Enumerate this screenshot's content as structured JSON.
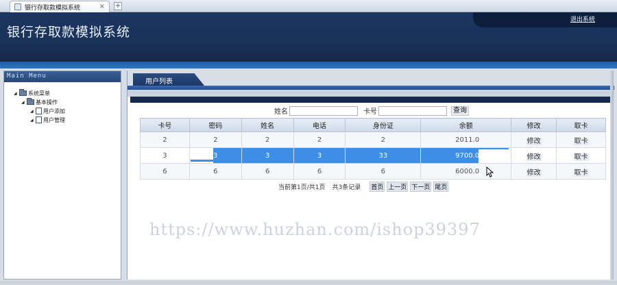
{
  "browser": {
    "tab_title": "银行存取款模拟系统",
    "tab_close": "×",
    "new_tab": "+"
  },
  "header": {
    "title": "银行存取款模拟系统",
    "logout": "退出系统"
  },
  "sidebar": {
    "heading": "Main Menu",
    "items": [
      {
        "label": "系统菜单",
        "level": 1,
        "icon": "folder-icon"
      },
      {
        "label": "基本操作",
        "level": 2,
        "icon": "folder-icon"
      },
      {
        "label": "用户添加",
        "level": 3,
        "icon": "page-icon"
      },
      {
        "label": "用户管理",
        "level": 3,
        "icon": "page-icon"
      }
    ]
  },
  "content": {
    "tab_label": "用户列表"
  },
  "search": {
    "name_label": "姓名",
    "name_value": "",
    "card_label": "卡号",
    "card_value": "",
    "button": "查询"
  },
  "table": {
    "columns": [
      "卡号",
      "密码",
      "姓名",
      "电话",
      "身份证",
      "余额",
      "修改",
      "取卡"
    ],
    "rows": [
      {
        "card": "2",
        "password": "2",
        "name": "2",
        "phone": "2",
        "id_card": "2",
        "balance": "2011.0",
        "edit": "修改",
        "withdraw": "取卡"
      },
      {
        "card": "3",
        "password": "3",
        "name": "3",
        "phone": "3",
        "id_card": "33",
        "balance": "9700.0",
        "edit": "修改",
        "withdraw": "取卡",
        "selected": true
      },
      {
        "card": "6",
        "password": "6",
        "name": "6",
        "phone": "6",
        "id_card": "6",
        "balance": "6000.0",
        "edit": "修改",
        "withdraw": "取卡"
      }
    ]
  },
  "pagination": {
    "page_info": "当前第1页/共1页",
    "total": "共3条记录",
    "first": "首页",
    "prev": "上一页",
    "next": "下一页",
    "last": "尾页"
  },
  "watermark": "https://www.huzhan.com/ishop39397",
  "colors": {
    "header": "#1d3660",
    "accent": "#3c8ee6",
    "band": "#1b5fa8"
  }
}
